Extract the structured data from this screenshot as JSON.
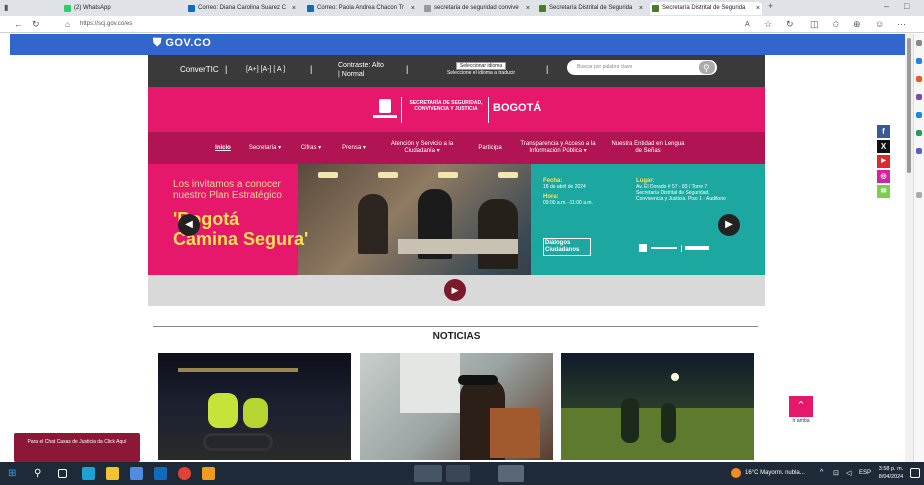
{
  "browser": {
    "tabs": [
      {
        "label": "(2) WhatsApp",
        "fav": "#25d366"
      },
      {
        "label": "Correo: Diana Carolina Suarez C",
        "fav": "#0f6cbd"
      },
      {
        "label": "Correo: Paola Andrea Chacon Tr",
        "fav": "#0f6cbd"
      },
      {
        "label": "secretaria de seguridad convive",
        "fav": "#999999"
      },
      {
        "label": "Secretaría Distrital de Segurida",
        "fav": "#4a7a2a"
      },
      {
        "label": "Secretaría Distrital de Segurida",
        "fav": "#4a7a2a"
      }
    ],
    "url": "https://scj.gov.co/es"
  },
  "gov": {
    "logo": "GOV.CO"
  },
  "topnav": {
    "convertic": "ConverTIC",
    "fontsize": "[A+]  [A-]  [ A ]",
    "contrast_line1": "Contraste: Alto",
    "contrast_line2": "| Normal",
    "lang_select": "Seleccionar idioma",
    "lang_hint": "Seleccione el idioma a traducir",
    "search_placeholder": "Buscar por palabra clave"
  },
  "brand": {
    "secretaria": "SECRETARÍA DE SEGURIDAD, CONVIVENCIA Y JUSTICIA",
    "city": "BOGOTÁ"
  },
  "mainnav": [
    {
      "label": "Inicio"
    },
    {
      "label": "Secretaría ▾"
    },
    {
      "label": "Cifras ▾"
    },
    {
      "label": "Prensa ▾"
    },
    {
      "label": "Atención y Servicio a la Ciudadanía ▾"
    },
    {
      "label": "Participa"
    },
    {
      "label": "Transparencia y Acceso a la Información Pública ▾"
    },
    {
      "label": "Nuestra Entidad en Lengua de Señas"
    }
  ],
  "banner": {
    "intro": "Los invitamos a conocer nuestro Plan Estratégico",
    "slogan_1": "'Bogotá",
    "slogan_2": "Camina Segura'",
    "fecha_label": "Fecha:",
    "fecha": "18 de abril de 2024",
    "hora_label": "Hora:",
    "hora": "09:00 a.m. -11:00 a.m.",
    "lugar_label": "Lugar:",
    "lugar": "Av. El Dorado # 57 - 83 / Torre 7 Secretaría Distrital de Seguridad, Convivencia y Justicia. Piso 1 - Auditorio",
    "dialogos": "Diálogos Ciudadanos"
  },
  "news": {
    "title": "NOTICIAS"
  },
  "chat": {
    "label": "Para el Chat Casas de Justicia da Click Aquí"
  },
  "gotop": {
    "label": "Ir arriba"
  },
  "taskbar": {
    "weather": "16°C  Mayorm. nubla...",
    "lang": "ESP",
    "time": "3:58 p. m.",
    "date": "8/04/2024"
  }
}
